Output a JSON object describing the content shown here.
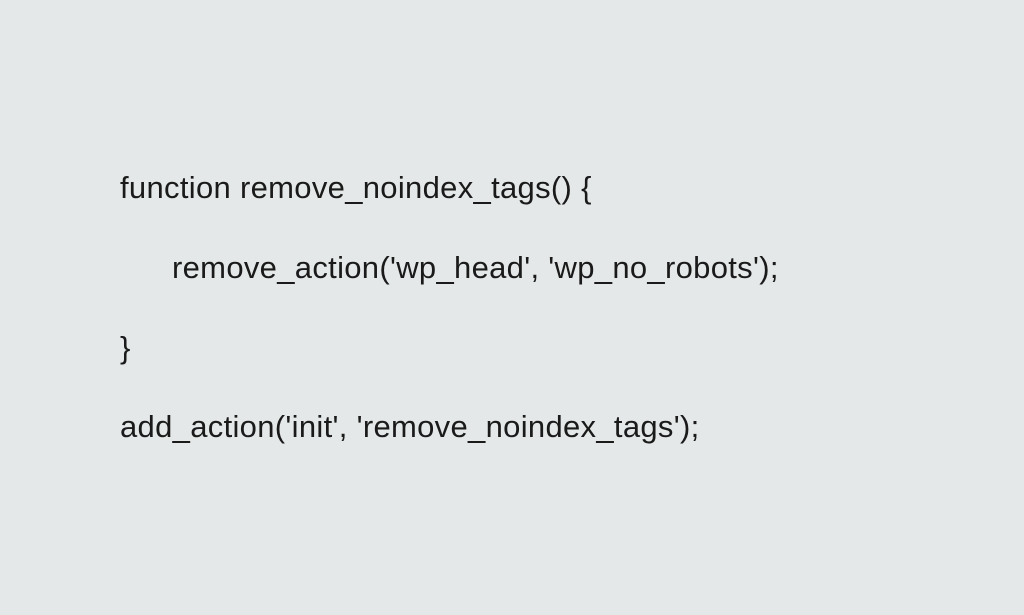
{
  "code": {
    "line1": "function remove_noindex_tags() {",
    "line2": "remove_action('wp_head', 'wp_no_robots');",
    "line3": "}",
    "line4": "add_action('init', 'remove_noindex_tags');"
  }
}
